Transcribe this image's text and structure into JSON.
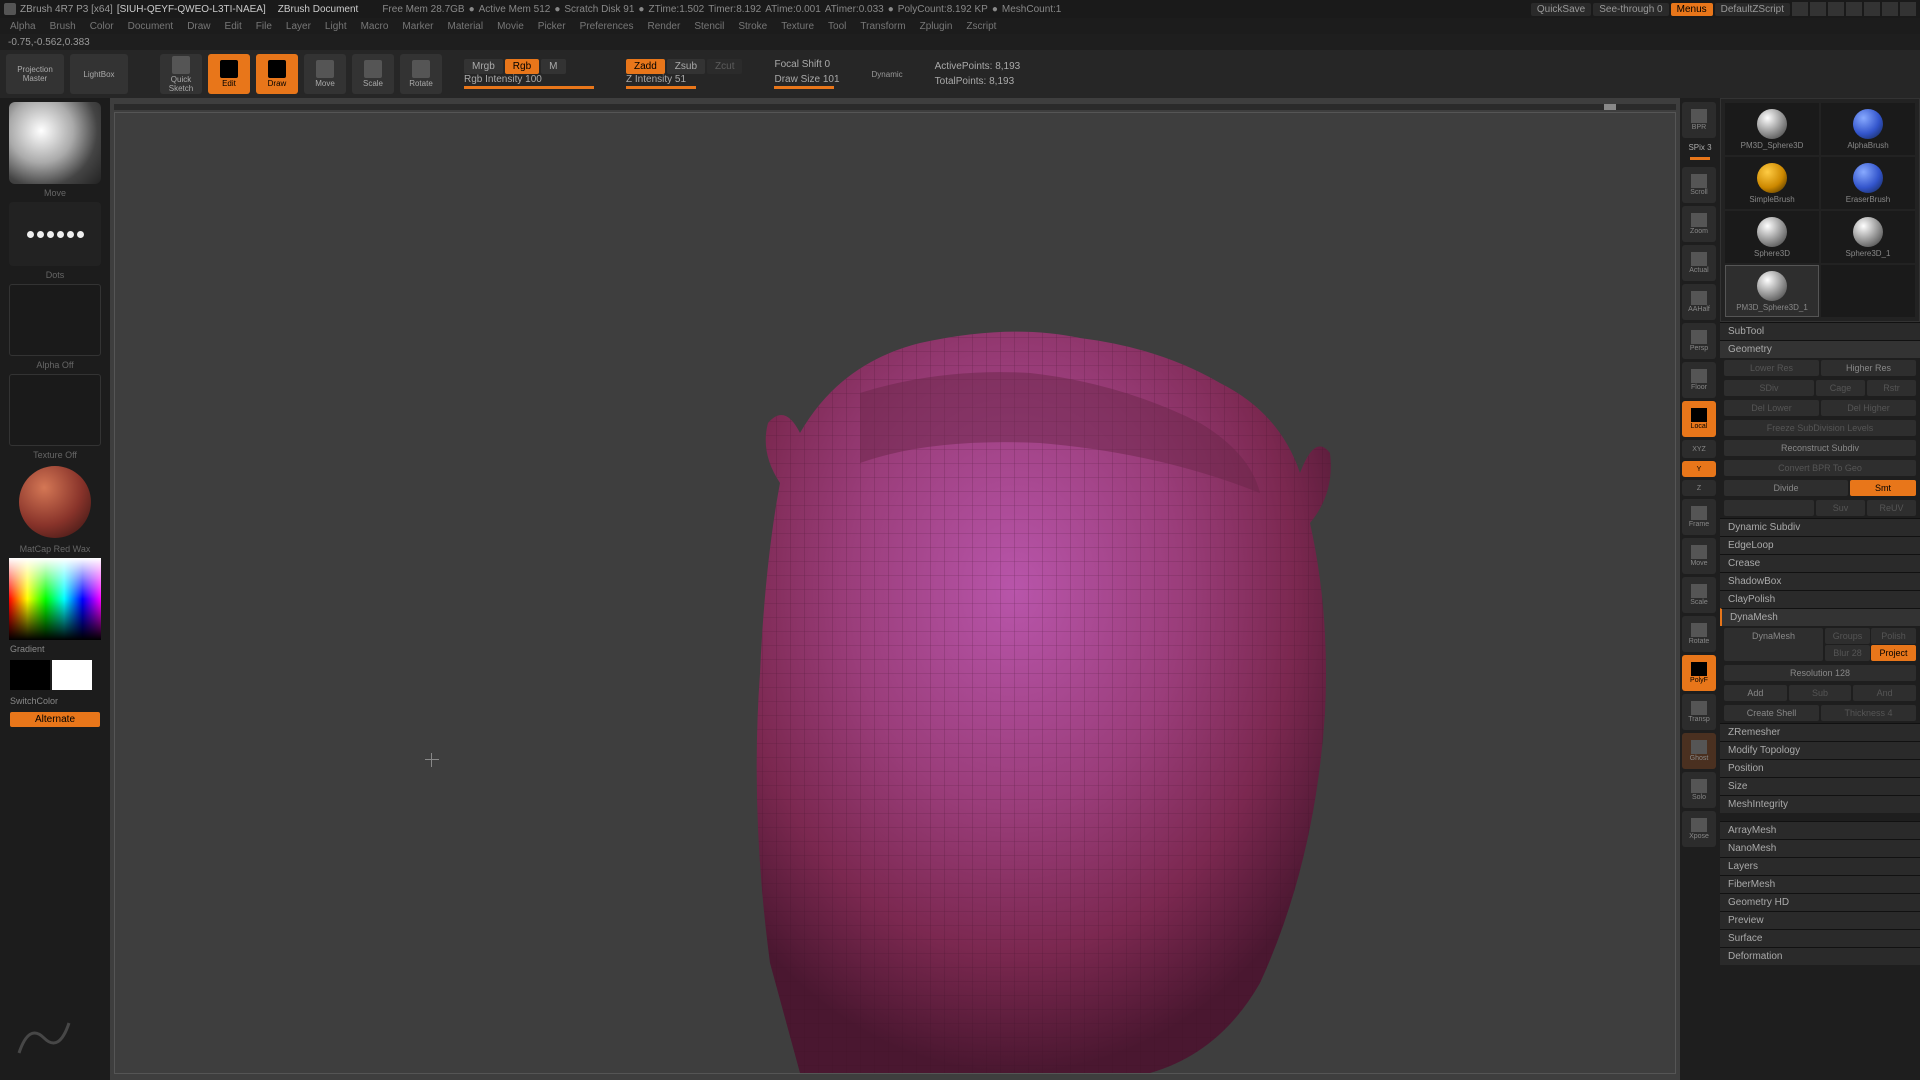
{
  "title": {
    "app": "ZBrush 4R7 P3  [x64]",
    "project": "[SIUH-QEYF-QWEO-L3TI-NAEA]",
    "doc": "ZBrush Document"
  },
  "stats": {
    "free_mem": "Free Mem  28.7GB",
    "active_mem": "Active Mem  512",
    "scratch": "Scratch Disk  91",
    "ztime": "ZTime:1.502",
    "timer": "Timer:8.192",
    "atime": "ATime:0.001",
    "atimer": "ATimer:0.033",
    "polycount": "PolyCount:8.192 KP",
    "meshcount": "MeshCount:1"
  },
  "titlebar_right": {
    "quicksave": "QuickSave",
    "seethrough": "See-through   0",
    "menus": "Menus",
    "script": "DefaultZScript"
  },
  "menubar": [
    "Alpha",
    "Brush",
    "Color",
    "Document",
    "Draw",
    "Edit",
    "File",
    "Layer",
    "Light",
    "Macro",
    "Marker",
    "Material",
    "Movie",
    "Picker",
    "Preferences",
    "Render",
    "Stencil",
    "Stroke",
    "Texture",
    "Tool",
    "Transform",
    "Zplugin",
    "Zscript"
  ],
  "coords": "-0.75,-0.562,0.383",
  "toolbar": {
    "projection": "Projection\nMaster",
    "lightbox": "LightBox",
    "quicksketch": "Quick\nSketch",
    "edit": "Edit",
    "draw": "Draw",
    "move": "Move",
    "scale": "Scale",
    "rotate": "Rotate",
    "mrgb": "Mrgb",
    "rgb": "Rgb",
    "m": "M",
    "rgb_int": "Rgb Intensity 100",
    "zadd": "Zadd",
    "zsub": "Zsub",
    "zcut": "Zcut",
    "z_int": "Z Intensity 51",
    "focal": "Focal Shift 0",
    "draw_size": "Draw Size 101",
    "dynamic": "Dynamic",
    "active_pts": "ActivePoints: 8,193",
    "total_pts": "TotalPoints: 8,193"
  },
  "left": {
    "brush": "Move",
    "stroke": "Dots",
    "alpha": "Alpha  Off",
    "texture": "Texture Off",
    "material": "MatCap Red Wax",
    "gradient": "Gradient",
    "switch": "SwitchColor",
    "alternate": "Alternate"
  },
  "rsidebar": {
    "bpr": "BPR",
    "spix": "SPix 3",
    "items": [
      "Scroll",
      "Zoom",
      "Actual",
      "AAHalf",
      "Persp",
      "Floor",
      "Local",
      "XYZ",
      "Y",
      "Z",
      "Frame",
      "Move",
      "Scale",
      "Rotate",
      "PolyF",
      "Transp",
      "Ghost",
      "Solo",
      "Xpose"
    ]
  },
  "tools": [
    "PM3D_Sphere3D",
    "AlphaBrush",
    "SimpleBrush",
    "EraserBrush",
    "Sphere3D",
    "Sphere3D_1",
    "PM3D_Sphere3D_1"
  ],
  "right": {
    "subtool": "SubTool",
    "geometry": "Geometry",
    "lower_res": "Lower Res",
    "higher_res": "Higher Res",
    "sdiv": "SDiv",
    "cage": "Cage",
    "rstr": "Rstr",
    "del_lower": "Del Lower",
    "del_higher": "Del Higher",
    "freeze": "Freeze SubDivision Levels",
    "reconstruct": "Reconstruct Subdiv",
    "convert": "Convert BPR To Geo",
    "divide": "Divide",
    "smt": "Smt",
    "suv": "Suv",
    "resl": "ReUV",
    "dynamic_subdiv": "Dynamic Subdiv",
    "edgeloop": "EdgeLoop",
    "crease": "Crease",
    "shadowbox": "ShadowBox",
    "claypolish": "ClayPolish",
    "dynamesh_hdr": "DynaMesh",
    "dynamesh_btn": "DynaMesh",
    "groups": "Groups",
    "polish": "Polish",
    "blur": "Blur 28",
    "project": "Project",
    "resolution": "Resolution 128",
    "add": "Add",
    "sub": "Sub",
    "and": "And",
    "create_shell": "Create Shell",
    "thickness": "Thickness 4",
    "zremesher": "ZRemesher",
    "modify_topo": "Modify Topology",
    "position": "Position",
    "size": "Size",
    "mesh_integ": "MeshIntegrity",
    "arraymesh": "ArrayMesh",
    "nanomesh": "NanoMesh",
    "layers": "Layers",
    "fibermesh": "FiberMesh",
    "geometry_hd": "Geometry HD",
    "preview": "Preview",
    "surface": "Surface",
    "deformation": "Deformation"
  }
}
